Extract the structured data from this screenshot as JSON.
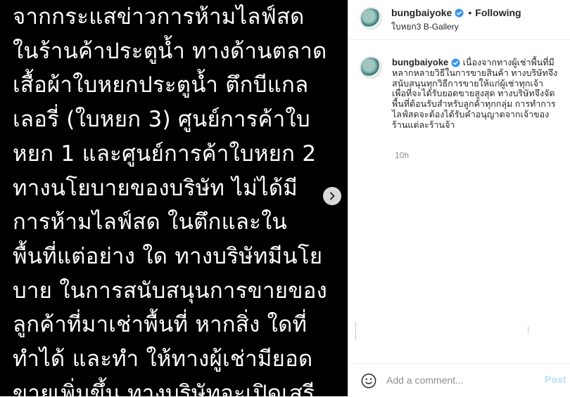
{
  "media": {
    "lines": [
      "จากกระแสข่าวการห้ามไลฟ์สด",
      "ในร้านค้าประตูน้ำ ทางด้านตลาด",
      "เสื้อผ้าใบหยกประตูน้ำ ตึกบีแกล",
      "เลอรี่ (ใบหยก 3) ศูนย์การค้าใบ",
      "หยก 1 และศูนย์การค้าใบหยก 2",
      "ทางนโยบายของบริษัท ไม่ได้มี",
      "การห้ามไลฟ์สด ในตึกและใน",
      "พื้นที่แต่อย่าง ใด ทางบริษัทมีนโย",
      "บาย ในการสนับสนุนการขายของ",
      "ลูกค้าที่มาเช่าพื้นที่ หากสิ่ง ใดที่",
      "ทำได้ และทำ ให้ทางผู้เช่ามียอด",
      "ขายเพิ่มขึ้น ทางบริษัทจะเปิดเสรี"
    ],
    "next_icon": "chevron-right-icon"
  },
  "header": {
    "username": "bungbaiyoke",
    "separator": "•",
    "follow_status": "Following",
    "location": "ใบหยก3 B-Gallery",
    "verified_icon": "verified-badge-icon"
  },
  "caption": {
    "username": "bungbaiyoke",
    "lines": [
      " เนื่องจากทางผู้เช่าพื้นที่มี",
      "หลากหลายวิธีในการขายสินค้า ทางบริษัทจึง",
      "สนับสนุนทุกวิธีการขายให้แก่ผู้เช่าทุกเจ้า",
      "เพื่อที่จะได้รับยอดขายสูงสุด ทางบริษัทจึงจัด",
      "พื้นที่ต้อนรับสำหรับลูกค้าทุกกลุ่ม การทำการ",
      "ไลฟ์สดจะต้องได้รับคำอนุญาตจากเจ้าของ",
      "ร้านแต่ละร้านจ้า"
    ],
    "time": "10h"
  },
  "comment": {
    "placeholder": "Add a comment...",
    "post_label": "Post",
    "emoji_icon": "smiley-icon"
  },
  "colors": {
    "verified": "#3897f0",
    "post_disabled": "#b2dffc",
    "media_bg": "#000000"
  }
}
